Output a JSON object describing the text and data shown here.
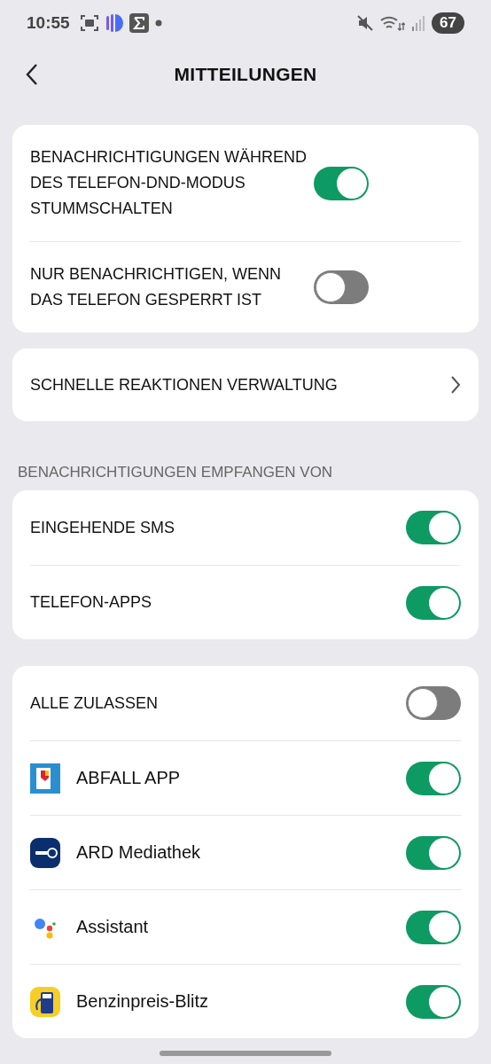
{
  "status_bar": {
    "time": "10:55",
    "battery": "67"
  },
  "header": {
    "title": "MITTEILUNGEN"
  },
  "general": [
    {
      "label": "BENACHRICHTIGUNGEN WÄHREND DES TELEFON-DND-MODUS STUMMSCHALTEN",
      "on": true
    },
    {
      "label": "NUR BENACHRICHTIGEN, WENN DAS TELEFON GESPERRT IST",
      "on": false
    }
  ],
  "quick_reactions": {
    "label": "SCHNELLE REAKTIONEN VERWALTUNG"
  },
  "section_label": "BENACHRICHTIGUNGEN EMPFANGEN VON",
  "sources": [
    {
      "label": "EINGEHENDE SMS",
      "on": true
    },
    {
      "label": "TELEFON-APPS",
      "on": true
    }
  ],
  "allow_all": {
    "label": "ALLE ZULASSEN",
    "on": false
  },
  "apps": [
    {
      "name": "ABFALL APP",
      "on": true
    },
    {
      "name": "ARD Mediathek",
      "on": true
    },
    {
      "name": "Assistant",
      "on": true
    },
    {
      "name": "Benzinpreis-Blitz",
      "on": true
    }
  ]
}
